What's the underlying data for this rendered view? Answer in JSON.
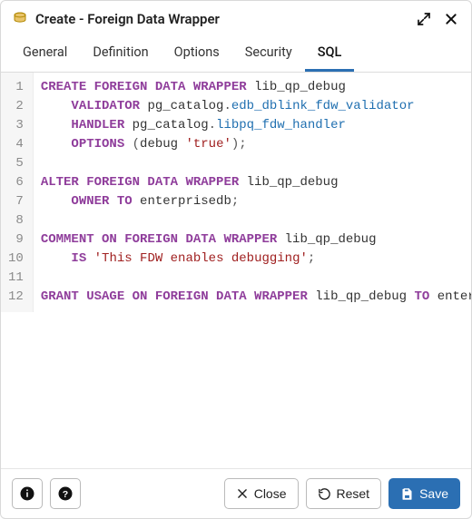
{
  "titlebar": {
    "title": "Create - Foreign Data Wrapper"
  },
  "tabs": [
    {
      "label": "General",
      "active": false
    },
    {
      "label": "Definition",
      "active": false
    },
    {
      "label": "Options",
      "active": false
    },
    {
      "label": "Security",
      "active": false
    },
    {
      "label": "SQL",
      "active": true
    }
  ],
  "sql": {
    "lines": [
      [
        {
          "cls": "kw",
          "text": "CREATE FOREIGN DATA WRAPPER "
        },
        {
          "cls": "ident",
          "text": "lib_qp_debug"
        }
      ],
      [
        {
          "cls": "ident",
          "text": "    "
        },
        {
          "cls": "kw",
          "text": "VALIDATOR "
        },
        {
          "cls": "ident",
          "text": "pg_catalog"
        },
        {
          "cls": "punct",
          "text": "."
        },
        {
          "cls": "func",
          "text": "edb_dblink_fdw_validator"
        }
      ],
      [
        {
          "cls": "ident",
          "text": "    "
        },
        {
          "cls": "kw",
          "text": "HANDLER "
        },
        {
          "cls": "ident",
          "text": "pg_catalog"
        },
        {
          "cls": "punct",
          "text": "."
        },
        {
          "cls": "func",
          "text": "libpq_fdw_handler"
        }
      ],
      [
        {
          "cls": "ident",
          "text": "    "
        },
        {
          "cls": "kw",
          "text": "OPTIONS "
        },
        {
          "cls": "punct",
          "text": "("
        },
        {
          "cls": "ident",
          "text": "debug "
        },
        {
          "cls": "str",
          "text": "'true'"
        },
        {
          "cls": "punct",
          "text": ");"
        }
      ],
      [],
      [
        {
          "cls": "kw",
          "text": "ALTER FOREIGN DATA WRAPPER "
        },
        {
          "cls": "ident",
          "text": "lib_qp_debug"
        }
      ],
      [
        {
          "cls": "ident",
          "text": "    "
        },
        {
          "cls": "kw",
          "text": "OWNER TO "
        },
        {
          "cls": "ident",
          "text": "enterprisedb"
        },
        {
          "cls": "punct",
          "text": ";"
        }
      ],
      [],
      [
        {
          "cls": "kw",
          "text": "COMMENT ON FOREIGN DATA WRAPPER "
        },
        {
          "cls": "ident",
          "text": "lib_qp_debug"
        }
      ],
      [
        {
          "cls": "ident",
          "text": "    "
        },
        {
          "cls": "kw",
          "text": "IS "
        },
        {
          "cls": "str",
          "text": "'This FDW enables debugging'"
        },
        {
          "cls": "punct",
          "text": ";"
        }
      ],
      [],
      [
        {
          "cls": "kw",
          "text": "GRANT USAGE ON FOREIGN DATA WRAPPER "
        },
        {
          "cls": "ident",
          "text": "lib_qp_debug "
        },
        {
          "cls": "kw",
          "text": "TO "
        },
        {
          "cls": "ident",
          "text": "enterprisedb;"
        }
      ]
    ]
  },
  "footer": {
    "close_label": "Close",
    "reset_label": "Reset",
    "save_label": "Save"
  }
}
